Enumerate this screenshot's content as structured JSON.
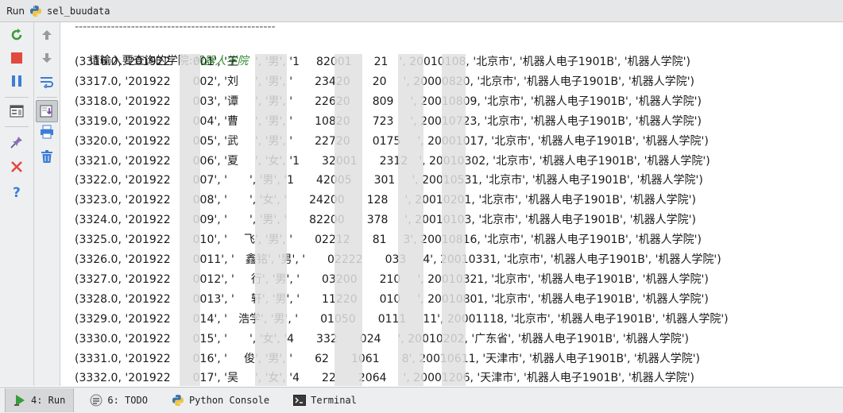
{
  "titlebar": {
    "run_label": "Run",
    "config_name": "sel_buudata"
  },
  "toolbar": {
    "left": [
      "rerun-icon",
      "stop-icon",
      "pause-icon",
      "layout-icon",
      "pin-icon",
      "close-icon",
      "help-icon"
    ],
    "right": [
      "up-arrow-icon",
      "down-arrow-icon",
      "soft-wrap-icon",
      "scroll-to-end-icon",
      "print-icon",
      "trash-icon"
    ]
  },
  "console": {
    "separator": "--------------------------------------------------",
    "prompt": "请输入要查询的学院:",
    "input_value": "机器人学院",
    "rows": [
      "(3316.0, '201922    001', '王   ', '男', '1   82001    21  ', 20010108, '北京市', '机器人电子1901B', '机器人学院')",
      "(3317.0, '201922    002', '刘   ', '男', '    23420    20   ', 20000820, '北京市', '机器人电子1901B', '机器人学院')",
      "(3318.0, '201922    003', '谭   ', '男', '    22620    809   ', 20010809, '北京市', '机器人电子1901B', '机器人学院')",
      "(3319.0, '201922    004', '曹   ', '男', '    10820    723   ', 20010723, '北京市', '机器人电子1901B', '机器人学院')",
      "(3320.0, '201922    005', '武   ', '男', '    22720    0175   ', 20001017, '北京市', '机器人电子1901B', '机器人学院')",
      "(3321.0, '201922    006', '夏   ', '女', '1    32001    2312  ', 20010302, '北京市', '机器人电子1901B', '机器人学院')",
      "(3322.0, '201922    007', '    ', '男', '1    42005    301   ', 20010531, '北京市', '机器人电子1901B', '机器人学院')",
      "(3323.0, '201922    008', '    ', '女', '    24200    128   ', 20010201, '北京市', '机器人电子1901B', '机器人学院')",
      "(3324.0, '201922    009', '    ', '男', '    82200    378   ', 20010103, '北京市', '机器人电子1901B', '机器人学院')",
      "(3325.0, '201922    010', '   飞', '男', '    02212    81   3', 20010816, '北京市', '机器人电子1901B', '机器人学院')",
      "(3326.0, '201922    0011', '  鑫铭', '男', '    02222    033   4', 20010331, '北京市', '机器人电子1901B', '机器人学院')",
      "(3327.0, '201922    0012', '   行', '男', '    03200    210   ', 20010321, '北京市', '机器人电子1901B', '机器人学院')",
      "(3328.0, '201922    0013', '   轩', '男', '    11220    010   ', 20010801, '北京市', '机器人电子1901B', '机器人学院')",
      "(3329.0, '201922    014', '  浩学', '男', '    01050    0111   11', 20001118, '北京市', '机器人电子1901B', '机器人学院')",
      "(3330.0, '201922    015', '    ', '女', '4    332    024   ', 20010202, '广东省', '机器人电子1901B', '机器人学院')",
      "(3331.0, '201922    016', '   俊', '男', '    62    1061    8', 20010611, '天津市', '机器人电子1901B', '机器人学院')",
      "(3332.0, '201922    017', '吴   ', '女', '4    22    2064   ', 20001206, '天津市', '机器人电子1901B', '机器人学院')"
    ]
  },
  "bottom_tabs": [
    {
      "label": "4: Run",
      "icon": "run-icon",
      "active": true
    },
    {
      "label": "6: TODO",
      "icon": "todo-icon",
      "active": false
    },
    {
      "label": "Python Console",
      "icon": "python-console-icon",
      "active": false
    },
    {
      "label": "Terminal",
      "icon": "terminal-icon",
      "active": false
    }
  ],
  "colors": {
    "input_value": "#2f8a2f",
    "accent_green": "#3a9b3a",
    "stop_red": "#e04a3f",
    "blue": "#3d7dd6"
  }
}
